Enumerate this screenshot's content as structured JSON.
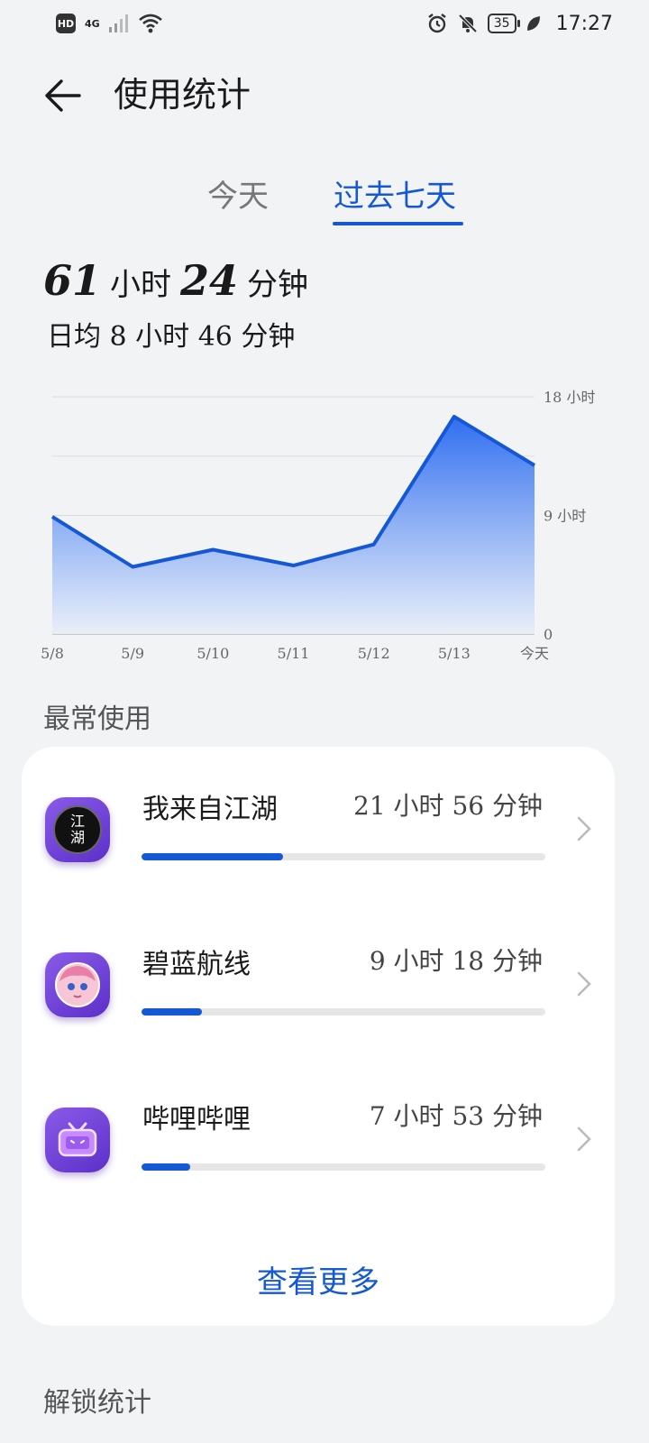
{
  "status_bar": {
    "hd": "HD",
    "network": "4G",
    "battery": "35",
    "time": "17:27"
  },
  "header": {
    "title": "使用统计"
  },
  "tabs": [
    {
      "label": "今天",
      "active": false
    },
    {
      "label": "过去七天",
      "active": true
    }
  ],
  "summary": {
    "hours": "61",
    "hours_unit": "小时",
    "minutes": "24",
    "minutes_unit": "分钟",
    "average": "日均 8 小时 46 分钟"
  },
  "chart_data": {
    "type": "area",
    "categories": [
      "5/8",
      "5/9",
      "5/10",
      "5/11",
      "5/12",
      "5/13",
      "今天"
    ],
    "values": [
      8.9,
      5.1,
      6.4,
      5.2,
      6.8,
      16.5,
      12.8
    ],
    "ylim": [
      0,
      18
    ],
    "y_tick_labels": [
      "18 小时",
      "9 小时",
      "0"
    ],
    "y_ticks": [
      18,
      9,
      0
    ],
    "gridlines": [
      0,
      4.5,
      9,
      13.5,
      18
    ],
    "grid": true,
    "line_color": "#1558d6",
    "fill_color": "#3a78f0"
  },
  "most_used": {
    "title": "最常使用",
    "apps": [
      {
        "name": "我来自江湖",
        "time": "21 小时 56 分钟",
        "progress": 0.35,
        "icon": "jianghu-app-icon",
        "icon_text": "江湖"
      },
      {
        "name": "碧蓝航线",
        "time": "9 小时 18 分钟",
        "progress": 0.15,
        "icon": "azur-lane-app-icon",
        "icon_text": ""
      },
      {
        "name": "哔哩哔哩",
        "time": "7 小时 53 分钟",
        "progress": 0.12,
        "icon": "bilibili-app-icon",
        "icon_text": ""
      }
    ],
    "see_more": "查看更多"
  },
  "unlock_stats": {
    "title": "解锁统计"
  },
  "colors": {
    "accent": "#1558d6",
    "background": "#f1f3f5",
    "card": "#ffffff"
  }
}
